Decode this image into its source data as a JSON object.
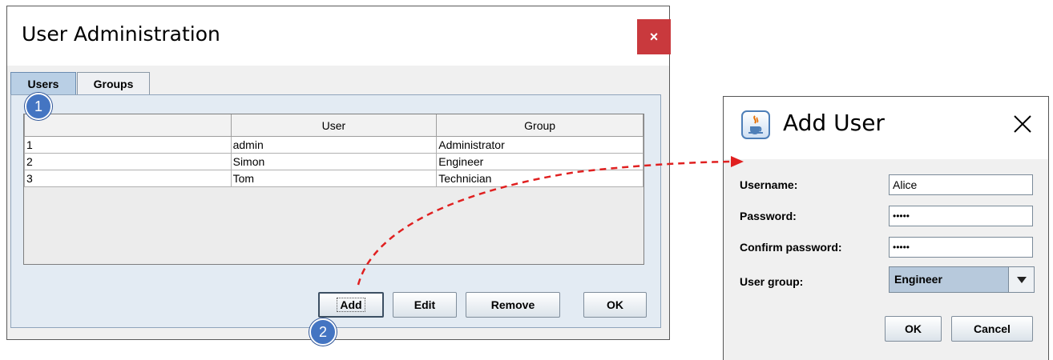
{
  "admin_window": {
    "title": "User Administration",
    "close_label": "×",
    "tabs": [
      {
        "label": "Users",
        "selected": true
      },
      {
        "label": "Groups",
        "selected": false
      }
    ],
    "table": {
      "columns": [
        "",
        "User",
        "Group"
      ],
      "rows": [
        [
          "1",
          "admin",
          "Administrator"
        ],
        [
          "2",
          "Simon",
          "Engineer"
        ],
        [
          "3",
          "Tom",
          "Technician"
        ]
      ]
    },
    "buttons": {
      "add": "Add",
      "edit": "Edit",
      "remove": "Remove",
      "ok": "OK"
    }
  },
  "callouts": {
    "step1": "1",
    "step2": "2",
    "badge_color": "#4475c2",
    "arrow_color": "#e02020"
  },
  "add_user_dialog": {
    "title": "Add User",
    "icon": "java-cup-icon",
    "close_icon": "close-x-icon",
    "fields": {
      "username_label": "Username:",
      "username_value": "Alice",
      "password_label": "Password:",
      "password_value": "•••••",
      "confirm_label": "Confirm password:",
      "confirm_value": "•••••",
      "group_label": "User group:",
      "group_value": "Engineer"
    },
    "buttons": {
      "ok": "OK",
      "cancel": "Cancel"
    }
  },
  "colors": {
    "close_button": "#c9393d",
    "selected_tab": "#b9cfe5",
    "select_highlight": "#b7c9dc"
  }
}
